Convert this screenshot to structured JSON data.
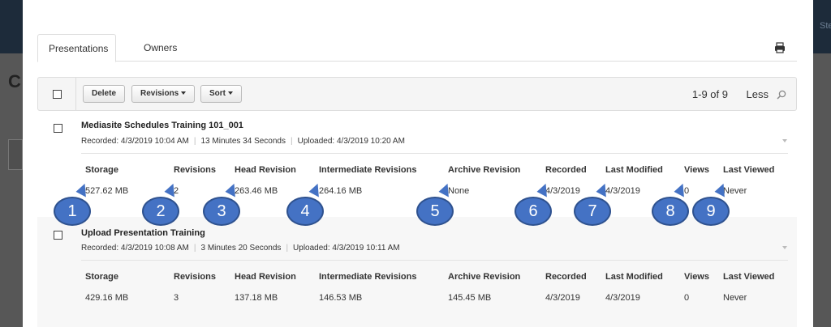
{
  "background": {
    "partial_letter": "C",
    "partial_right_text": "Ste"
  },
  "tabs": [
    {
      "label": "Presentations",
      "active": true
    },
    {
      "label": "Owners",
      "active": false
    }
  ],
  "toolbar": {
    "delete_label": "Delete",
    "revisions_label": "Revisions",
    "sort_label": "Sort",
    "pager": "1-9 of 9",
    "less_label": "Less"
  },
  "columns": [
    "Storage",
    "Revisions",
    "Head Revision",
    "Intermediate Revisions",
    "Archive Revision",
    "Recorded",
    "Last Modified",
    "Views",
    "Last Viewed"
  ],
  "items": [
    {
      "title": "Mediasite Schedules Training 101_001",
      "recorded": "Recorded: 4/3/2019 10:04 AM",
      "duration": "13 Minutes 34 Seconds",
      "uploaded": "Uploaded: 4/3/2019 10:20 AM",
      "values": [
        "527.62 MB",
        "2",
        "263.46 MB",
        "264.16 MB",
        "None",
        "4/3/2019",
        "4/3/2019",
        "0",
        "Never"
      ]
    },
    {
      "title": "Upload Presentation Training",
      "recorded": "Recorded: 4/3/2019 10:08 AM",
      "duration": "3 Minutes 20 Seconds",
      "uploaded": "Uploaded: 4/3/2019 10:11 AM",
      "values": [
        "429.16 MB",
        "3",
        "137.18 MB",
        "146.53 MB",
        "145.45 MB",
        "4/3/2019",
        "4/3/2019",
        "0",
        "Never"
      ]
    }
  ],
  "callouts": [
    "1",
    "2",
    "3",
    "4",
    "5",
    "6",
    "7",
    "8",
    "9"
  ],
  "colors": {
    "callout_fill": "#4472c4",
    "callout_border": "#2f528f",
    "overlay_dark": "#575757",
    "topbar": "#1d2b3a"
  }
}
